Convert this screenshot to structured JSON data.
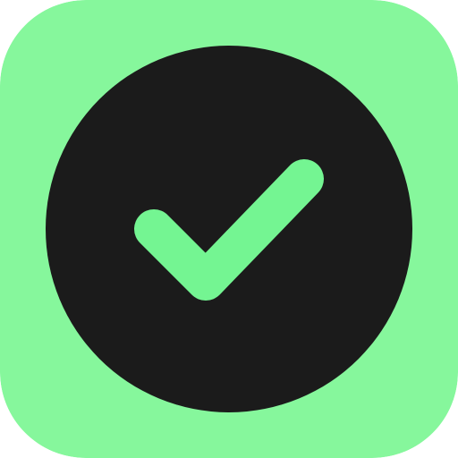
{
  "icon": {
    "name": "checkmark-circle-app-icon",
    "glyph": "check-icon",
    "colors": {
      "background": "#86f79c",
      "circle": "#1b1b1b",
      "check": "#74f592"
    }
  }
}
